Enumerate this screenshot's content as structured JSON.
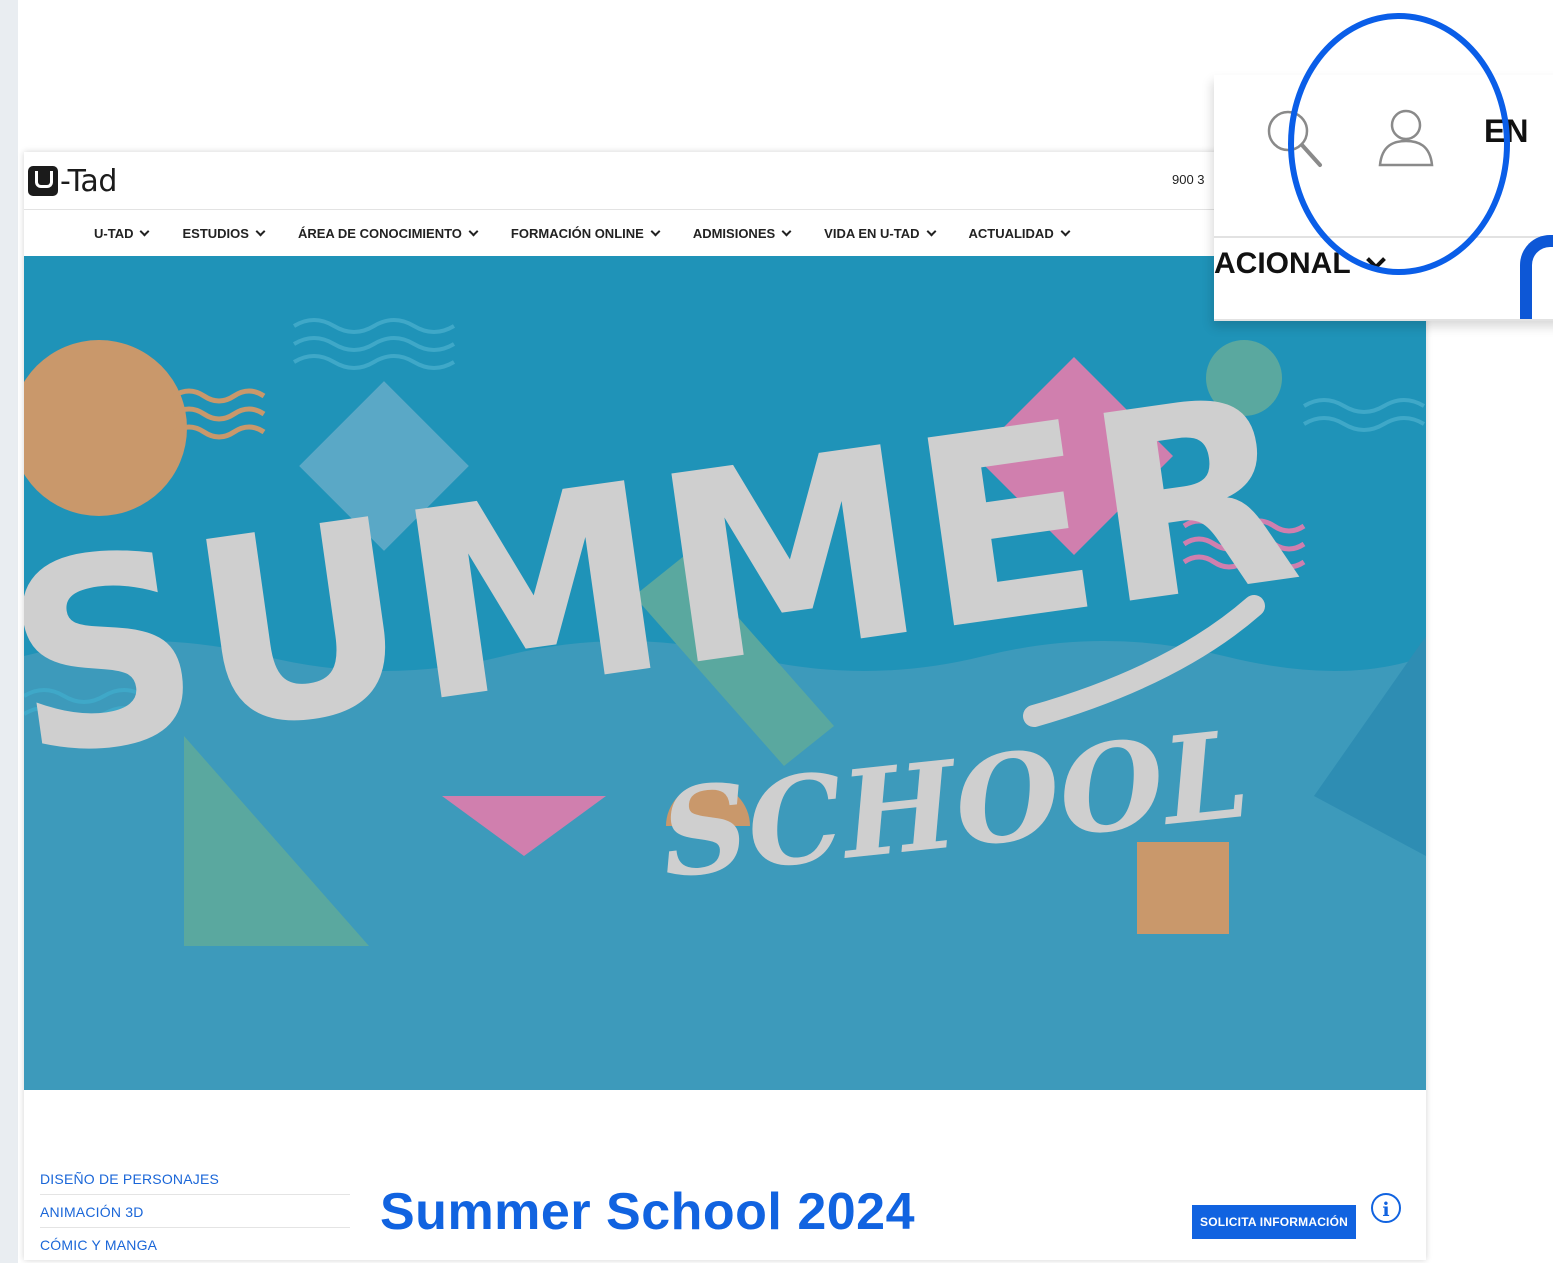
{
  "brand": {
    "logo_text": "-Tad"
  },
  "header": {
    "phone": "900 3"
  },
  "nav": {
    "items": [
      {
        "label": "U-TAD"
      },
      {
        "label": "ESTUDIOS"
      },
      {
        "label": "ÁREA DE CONOCIMIENTO"
      },
      {
        "label": "FORMACIÓN ONLINE"
      },
      {
        "label": "ADMISIONES"
      },
      {
        "label": "VIDA EN U-TAD"
      },
      {
        "label": "ACTUALIDAD"
      }
    ]
  },
  "hero": {
    "title_main": "SUMMER",
    "title_sub": "SCHOOL",
    "colors": {
      "bg": "#1f93b8",
      "lower_bg": "#3d9abb",
      "letters": "#cfcfcf",
      "orange": "#c9986b",
      "pink": "#d07fae",
      "teal": "#5aa89f"
    }
  },
  "sidebar": {
    "links": [
      {
        "label": "DISEÑO DE PERSONAJES"
      },
      {
        "label": "ANIMACIÓN 3D"
      },
      {
        "label": "CÓMIC Y MANGA"
      }
    ]
  },
  "content": {
    "title": "Summer School 2024",
    "cta_label": "SOLICITA INFORMACIÓN",
    "info_icon_label": "i"
  },
  "zoom": {
    "lang": "EN",
    "nav_fragment": "ACIONAL",
    "accent": "#0a5ee8"
  }
}
